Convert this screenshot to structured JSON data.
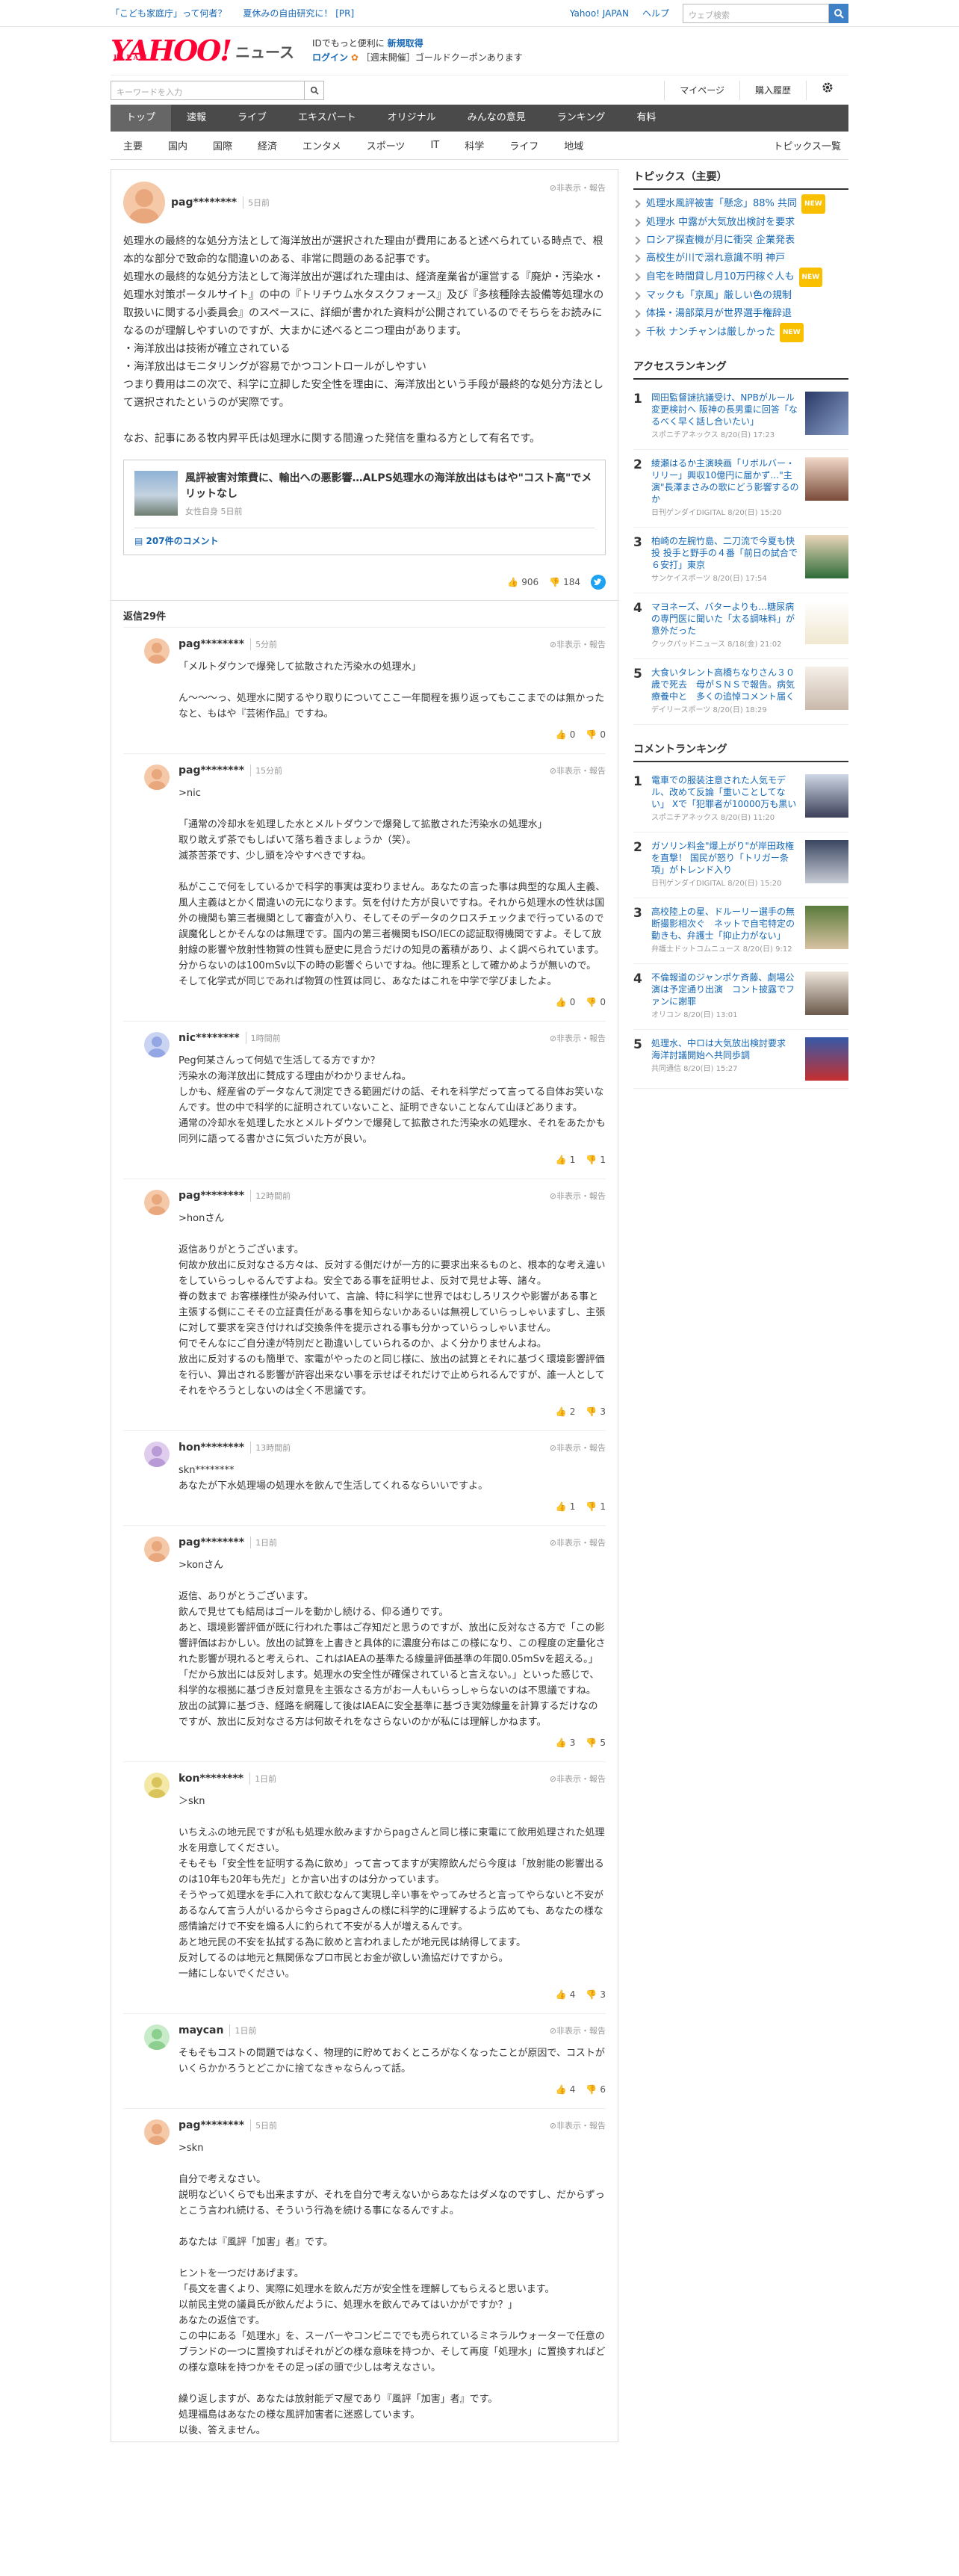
{
  "top_bar": {
    "links": [
      "「こども家庭庁」って何者？",
      "夏休みの自由研究に！ [PR]"
    ],
    "yahoo_japan": "Yahoo! JAPAN",
    "help": "ヘルプ",
    "search_placeholder": "ウェブ検索"
  },
  "header": {
    "logo": "YAHOO!",
    "logo_sub": "JAPAN",
    "section": "ニュース",
    "promo_line1": "IDでもっと便利に",
    "promo_signup": "新規取得",
    "promo_login": "ログイン",
    "promo_line2": "［週末開催］ゴールドクーポンあります"
  },
  "search_row": {
    "placeholder": "キーワードを入力",
    "mypage": "マイページ",
    "purchase": "購入履歴"
  },
  "global_nav": [
    "トップ",
    "速報",
    "ライブ",
    "エキスパート",
    "オリジナル",
    "みんなの意見",
    "ランキング",
    "有料"
  ],
  "sub_nav": [
    "主要",
    "国内",
    "国際",
    "経済",
    "エンタメ",
    "スポーツ",
    "IT",
    "科学",
    "ライフ",
    "地域"
  ],
  "sub_nav_last": "トピックス一覧",
  "first_comment": {
    "user": "pag********",
    "time": "5日前",
    "report": "非表示・報告",
    "text": "処理水の最終的な処分方法として海洋放出が選択された理由が費用にあると述べられている時点で、根本的な部分で致命的な間違いのある、非常に問題のある記事です。\n処理水の最終的な処分方法として海洋放出が選ばれた理由は、経済産業省が運営する『廃炉・汚染水・処理水対策ポータルサイト』の中の『トリチウム水タスクフォース』及び『多核種除去設備等処理水の取扱いに関する小委員会』のスペースに、詳細が書かれた資料が公開されているのでそちらをお読みになるのが理解しやすいのですが、大まかに述べるとニつ理由があります。\n・海洋放出は技術が確立されている\n・海洋放出はモニタリングが容易でかつコントロールがしやすい\nつまり費用はニの次で、科学に立脚した安全性を理由に、海洋放出という手段が最終的な処分方法として選択されたというのが実際です。\n\nなお、記事にある牧内昇平氏は処理水に関する間違った発信を重ねる方として有名です。",
    "card_title": "風評被害対策費に、輸出への悪影響…ALPS処理水の海洋放出はもはや\"コスト高\"でメリットなし",
    "card_source": "女性自身 5日前",
    "card_comments": "207件のコメント",
    "likes": "906",
    "dislikes": "184"
  },
  "replies_header": "返信29件",
  "replies": [
    {
      "user": "pag********",
      "time": "5分前",
      "report": "非表示・報告",
      "text": "「メルトダウンで爆発して拡散された汚染水の処理水」\n\nん〜〜〜っ、処理水に関するやり取りについてここ一年間程を振り返ってもここまでのは無かったなと、もはや『芸術作品』ですね。",
      "likes": "0",
      "dislikes": "0"
    },
    {
      "user": "pag********",
      "time": "15分前",
      "report": "非表示・報告",
      "text": ">nic\n\n「通常の冷却水を処理した水とメルトダウンで爆発して拡散された汚染水の処理水」\n取り敢えず茶でもしばいて落ち着きましょうか（笑）。\n滅茶苦茶です、少し頭を冷やすべきですね。\n\n私がここで何をしているかで科学的事実は変わりません。あなたの言った事は典型的な風人主義、風人主義はとかく間違いの元になります。気を付けた方が良いですね。それから処理水の性状は国外の機関も第三者機関として審査が入り、そしてそのデータのクロスチェックまで行っているので誤魔化しとかそんなのは無理です。国内の第三者機関もISO/IECの認証取得機関ですよ。そして放射線の影響や放射性物質の性質も歴史に見合うだけの知見の蓄積があり、よく調べられています。分からないのは100mSv以下の時の影響ぐらいですね。他に理系として確かめようが無いので。そして化学式が同じであれば物質の性質は同じ、あなたはこれを中学で学びましたよ。",
      "likes": "0",
      "dislikes": "0"
    },
    {
      "user": "nic********",
      "time": "1時間前",
      "report": "非表示・報告",
      "text": "Peg何某さんって何処で生活してる方ですか？\n汚染水の海洋放出に賛成する理由がわかりませんね。\nしかも、経産省のデータなんて測定できる範囲だけの話、それを科学だって言ってる自体お笑いなんです。世の中で科学的に証明されていないこと、証明できないことなんて山ほどあります。\n通常の冷却水を処理した水とメルトダウンで爆発して拡散された汚染水の処理水、それをあたかも同列に語ってる書かさに気づいた方が良い。",
      "likes": "1",
      "dislikes": "1"
    },
    {
      "user": "pag********",
      "time": "12時間前",
      "report": "非表示・報告",
      "text": ">honさん\n\n返信ありがとうございます。\n何故か放出に反対なさる方々は、反対する側だけが一方的に要求出来るものと、根本的な考え違いをしていらっしゃるんですよね。安全である事を証明せよ、反対で見せよ等、諸々。\n脊の数まで お客様様性が染み付いて、言論、特に科学に世界ではむしろリスクや影響がある事と主張する側にこそその立証責任がある事を知らないかあるいは無視していらっしゃいますし、主張に対して要求を突き付ければ交換条件を提示される事も分かっていらっしゃいません。\n何でそんなにご自分達が特別だと勘違いしていられるのか、よく分かりませんよね。\n放出に反対するのも簡単で、家電がやったのと同じ様に、放出の試算とそれに基づく環境影響評価を行い、算出される影響が許容出来ない事を示せばそれだけで止められるんですが、誰一人としてそれをやろうとしないのは全く不思議です。",
      "likes": "2",
      "dislikes": "3"
    },
    {
      "user": "hon********",
      "time": "13時間前",
      "report": "非表示・報告",
      "text": "skn********\nあなたが下水処理場の処理水を飲んで生活してくれるならいいですよ。",
      "likes": "1",
      "dislikes": "1"
    },
    {
      "user": "pag********",
      "time": "1日前",
      "report": "非表示・報告",
      "text": ">konさん\n\n返信、ありがとうございます。\n飲んで見せても結局はゴールを動かし続ける、仰る通りです。\nあと、環境影響評価が既に行われた事はご存知だと思うのですが、放出に反対なさる方で「この影響評価はおかしい。放出の試算を上書きと具体的に濃度分布はこの様になり、この程度の定量化された影響が現れると考えられ、これはIAEAの基準たる線量評価基準の年間0.05mSvを超える。」「だから放出には反対します。処理水の安全性が確保されていると言えない。」といった感じで、科学的な根拠に基づき反対意見を主張なさる方がお一人もいらっしゃらないのは不思議ですね。\n放出の試算に基づき、経路を網羅して後はIAEAに安全基準に基づき実効線量を計算するだけなのですが、放出に反対なさる方は何故それをなさらないのかが私には理解しかねます。",
      "likes": "3",
      "dislikes": "5"
    },
    {
      "user": "kon********",
      "time": "1日前",
      "report": "非表示・報告",
      "text": "＞skn\n\nいちえふの地元民ですが私も処理水飲みますからpagさんと同じ様に東電にて飲用処理された処理水を用意してください。\nそもそも「安全性を証明する為に飲め」って言ってますが実際飲んだら今度は「放射能の影響出るのは10年も20年も先だ」とか言い出すのは分かっています。\nそうやって処理水を手に入れて飲むなんて実現し辛い事をやってみせろと言ってやらないと不安があるなんて言う人がいるから今さらpagさんの様に科学的に理解するよう広めても、あなたの様な感情論だけで不安を煽る人に釣られて不安がる人が増えるんです。\nあと地元民の不安を払拭する為に飲めと言われましたが地元民は納得してます。\n反対してるのは地元と無関係なプロ市民とお金が欲しい漁協だけですから。\n一緒にしないでください。",
      "likes": "4",
      "dislikes": "3"
    },
    {
      "user": "maycan",
      "time": "1日前",
      "report": "非表示・報告",
      "text": "そもそもコストの問題ではなく、物理的に貯めておくところがなくなったことが原因で、コストがいくらかかろうとどこかに捨てなきゃならんって話。",
      "likes": "4",
      "dislikes": "6"
    },
    {
      "user": "pag********",
      "time": "5日前",
      "report": "非表示・報告",
      "text": ">skn\n\n自分で考えなさい。\n説明などいくらでも出来ますが、それを自分で考えないからあなたはダメなのですし、だからずっとこう言われ続ける、そういう行為を続ける事になるんですよ。\n\nあなたは『風評「加害」者』です。\n\nヒントを一つだけあげます。\n「長文を書くより、実際に処理水を飲んだ方が安全性を理解してもらえると思います。\n以前民主党の議員氏が飲んだように、処理水を飲んでみてはいかがですか？」\nあなたの返信です。\nこの中にある「処理水」を、スーパーやコンビニででも売られているミネラルウォーターで任意のブランドの一つに置換すればそれがどの様な意味を持つか、そして再度「処理水」に置換すればどの様な意味を持つかをその足っぽの頭で少しは考えなさい。\n\n繰り返しますが、あなたは放射能デマ屋であり『風評「加害」者』です。\n処理福島はあなたの様な風評加害者に迷惑しています。\n以後、答えません。",
      "likes": "",
      "dislikes": ""
    }
  ],
  "sidebar": {
    "topics_title": "トピックス（主要）",
    "topics": [
      {
        "text": "処理水風評被害「懸念」88% 共同",
        "new": true
      },
      {
        "text": "処理水 中露が大気放出検討を要求",
        "new": false
      },
      {
        "text": "ロシア探査機が月に衝突 企業発表",
        "new": false
      },
      {
        "text": "高校生が川で溺れ意識不明 神戸",
        "new": false
      },
      {
        "text": "自宅を時間貸し月10万円稼ぐ人も",
        "new": true
      },
      {
        "text": "マックも「京風」厳しい色の規制",
        "new": false
      },
      {
        "text": "体操・湯部菜月が世界選手権辞退",
        "new": false
      },
      {
        "text": "千秋 ナンチャンは厳しかった",
        "new": true
      }
    ],
    "new_label": "NEW",
    "access_title": "アクセスランキング",
    "access": [
      {
        "n": "1",
        "title": "岡田監督謎抗議受け、NPBがルール変更検討へ 阪神の長男重に回答「なるべく早く話し合いたい」",
        "src": "スポニチアネックス 8/20(日) 17:23"
      },
      {
        "n": "2",
        "title": "綾瀬はるか主演映画「リボルバー・リリー」興収10億円に届かず…\"主演\"長澤まさみの歌にどう影響するのか",
        "src": "日刊ゲンダイDIGITAL 8/20(日) 15:20"
      },
      {
        "n": "3",
        "title": "柏崎の左腕竹島、二刀流で今夏も快投 投手と野手の４番「前日の試合で６安打」東京",
        "src": "サンケイスポーツ 8/20(日) 17:54"
      },
      {
        "n": "4",
        "title": "マヨネーズ、バターよりも…糖尿病の専門医に聞いた「太る調味料」が意外だった",
        "src": "クックパッドニュース 8/18(金) 21:02"
      },
      {
        "n": "5",
        "title": "大食いタレント高橋ちなりさん３０歳で死去　母がＳＮＳで報告。病気療養中と　多くの追悼コメント届く",
        "src": "デイリースポーツ 8/20(日) 18:29"
      }
    ],
    "comment_title": "コメントランキング",
    "comment_rank": [
      {
        "n": "1",
        "title": "電車での服装注意された人気モデル、改めて反論「重いことしてない」 Xで「犯罪者が10000万も黒い",
        "src": "スポニチアネックス 8/20(日) 11:20"
      },
      {
        "n": "2",
        "title": "ガソリン料金\"爆上がり\"が岸田政権を直撃！ 国民が怒り「トリガー条項」がトレンド入り",
        "src": "日刊ゲンダイDIGITAL 8/20(日) 15:20"
      },
      {
        "n": "3",
        "title": "高校陸上の星、ドルーリー選手の無断撮影相次ぐ　ネットで自宅特定の動きも、弁護士「抑止力がない」",
        "src": "弁護士ドットコムニュース 8/20(日) 9:12"
      },
      {
        "n": "4",
        "title": "不倫報道のジャンポケ斉藤、劇場公演は予定通り出演　コント披露でファンに謝罪",
        "src": "オリコン 8/20(日) 13:01"
      },
      {
        "n": "5",
        "title": "処理水、中ロは大気放出検討要求　海洋討議開始へ共同歩調",
        "src": "共同通信 8/20(日) 15:27"
      }
    ]
  }
}
